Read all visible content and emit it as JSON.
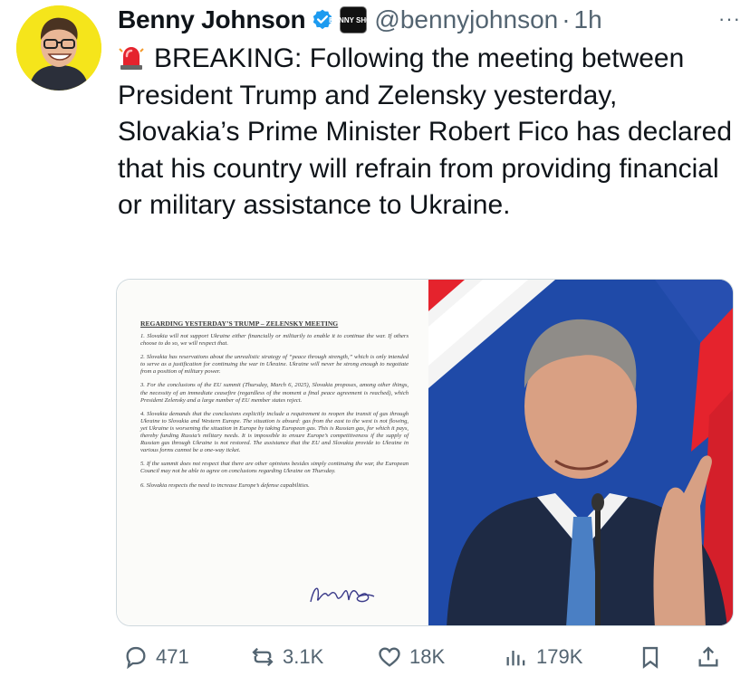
{
  "author": {
    "name": "Benny Johnson",
    "handle": "@bennyjohnson",
    "separator": "·",
    "time": "1h",
    "affiliation_badge": "BENNY SHOW",
    "more_menu": "···"
  },
  "tweet": {
    "text": "BREAKING: Following the meeting between President Trump and Zelensky yesterday, Slovakia’s Prime Minister Robert Fico has declared that his country will refrain from providing financial or military assistance to Ukraine.",
    "emoji": "siren-emoji"
  },
  "document": {
    "title": "REGARDING YESTERDAY’S TRUMP – ZELENSKY MEETING",
    "paragraphs": [
      "1. Slovakia will not support Ukraine either financially or militarily to enable it to continue the war. If others choose to do so, we will respect that.",
      "2. Slovakia has reservations about the unrealistic strategy of “peace through strength,” which is only intended to serve as a justification for continuing the war in Ukraine. Ukraine will never be strong enough to negotiate from a position of military power.",
      "3. For the conclusions of the EU summit (Thursday, March 6, 2025), Slovakia proposes, among other things, the necessity of an immediate ceasefire (regardless of the moment a final peace agreement is reached), which President Zelensky and a large number of EU member states reject.",
      "4. Slovakia demands that the conclusions explicitly include a requirement to reopen the transit of gas through Ukraine to Slovakia and Western Europe. The situation is absurd: gas from the east to the west is not flowing, yet Ukraine is worsening the situation in Europe by taking European gas. This is Russian gas, for which it pays, thereby funding Russia’s military needs. It is impossible to ensure Europe’s competitiveness if the supply of Russian gas through Ukraine is not restored. The assistance that the EU and Slovakia provide to Ukraine in various forms cannot be a one-way ticket.",
      "5. If the summit does not respect that there are other opinions besides simply continuing the war, the European Council may not be able to agree on conclusions regarding Ukraine on Thursday.",
      "6. Slovakia respects the need to increase Europe’s defense capabilities."
    ]
  },
  "actions": {
    "replies": "471",
    "reposts": "3.1K",
    "likes": "18K",
    "views": "179K"
  },
  "colors": {
    "text": "#0f1419",
    "secondary": "#536471",
    "verified": "#1d9bf0",
    "avatar_bg": "#f5e51b",
    "flag_blue": "#1f4aa8",
    "flag_red": "#e5232d"
  }
}
